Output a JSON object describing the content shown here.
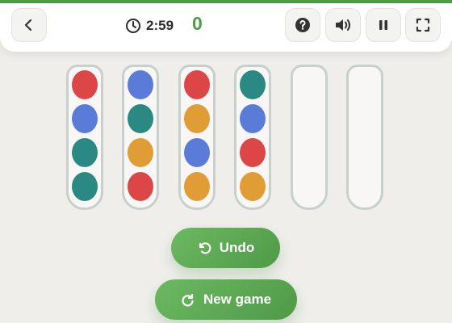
{
  "header": {
    "progress": 1.0,
    "timer": "2:59",
    "score": "0",
    "icons": [
      "back-icon",
      "clock-icon",
      "help-icon",
      "sound-icon",
      "pause-icon",
      "fullscreen-icon"
    ]
  },
  "board": {
    "tubes": [
      {
        "balls": [
          "red",
          "blue",
          "teal",
          "teal"
        ]
      },
      {
        "balls": [
          "blue",
          "teal",
          "orange",
          "red"
        ]
      },
      {
        "balls": [
          "red",
          "orange",
          "blue",
          "orange"
        ]
      },
      {
        "balls": [
          "teal",
          "blue",
          "red",
          "orange"
        ]
      },
      {
        "balls": []
      },
      {
        "balls": []
      }
    ]
  },
  "colors": {
    "red": "#dc4646",
    "blue": "#5b7bd8",
    "teal": "#2a8a83",
    "orange": "#e09d36",
    "accent": "#4e9c45"
  },
  "actions": {
    "undo_label": "Undo",
    "new_game_label": "New game"
  }
}
